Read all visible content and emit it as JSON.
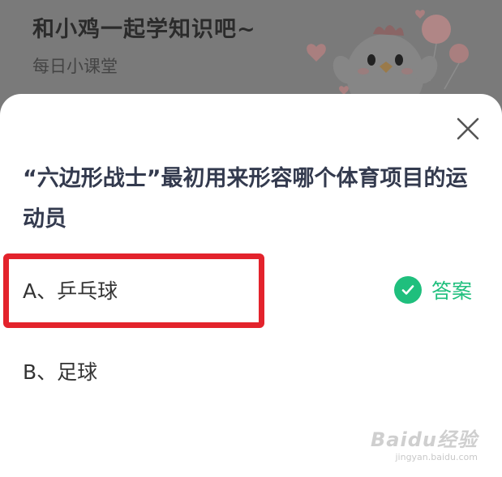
{
  "header": {
    "title": "和小鸡一起学知识吧~",
    "subtitle": "每日小课堂"
  },
  "quiz": {
    "question": "“六边形战士”最初用来形容哪个体育项目的运动员",
    "options": [
      {
        "label": "A、乒乓球",
        "selected": true
      },
      {
        "label": "B、足球",
        "selected": false
      }
    ],
    "answer_label": "答案"
  },
  "watermark": {
    "logo": "Baidu经验",
    "url": "jingyan.baidu.com"
  },
  "colors": {
    "accent_green": "#1fbf7d",
    "highlight_red": "#e3232c",
    "question_text": "#333a4e"
  },
  "icons": [
    "close-icon",
    "check-icon",
    "chicken-mascot",
    "heart-balloon"
  ]
}
